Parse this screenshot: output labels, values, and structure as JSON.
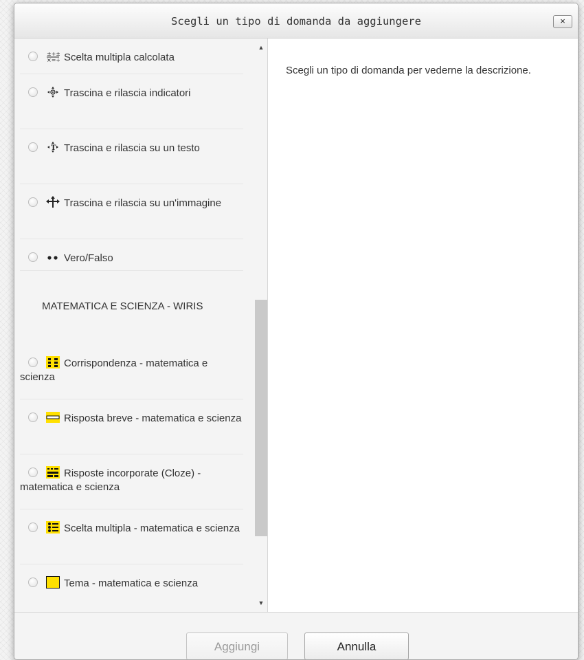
{
  "dialog": {
    "title": "Scegli un tipo di domanda da aggiungere",
    "close_glyph": "×"
  },
  "question_types": [
    {
      "label": "Scelta multipla calcolata",
      "icon": "calculated-multichoice-icon"
    },
    {
      "label": "Trascina e rilascia indicatori",
      "icon": "drag-drop-markers-icon"
    },
    {
      "label": "Trascina e rilascia su un testo",
      "icon": "drag-drop-text-icon"
    },
    {
      "label": "Trascina e rilascia su un'immagine",
      "icon": "drag-drop-image-icon"
    },
    {
      "label": "Vero/Falso",
      "icon": "true-false-icon"
    }
  ],
  "category": {
    "label": "MATEMATICA E SCIENZA - WIRIS"
  },
  "wiris_types": [
    {
      "label": "Corrispondenza - matematica e scienza",
      "icon": "wiris-match-icon"
    },
    {
      "label": "Risposta breve - matematica e scienza",
      "icon": "wiris-shortanswer-icon"
    },
    {
      "label": "Risposte incorporate (Cloze) - matematica e scienza",
      "icon": "wiris-cloze-icon"
    },
    {
      "label": "Scelta multipla - matematica e scienza",
      "icon": "wiris-multichoice-icon"
    },
    {
      "label": "Tema - matematica e scienza",
      "icon": "wiris-essay-icon"
    }
  ],
  "description": {
    "text": "Scegli un tipo di domanda per vederne la descrizione."
  },
  "buttons": {
    "add_label": "Aggiungi",
    "cancel_label": "Annulla"
  },
  "colors": {
    "wiris_icon": "#ffe000",
    "scroll_thumb": "#c9c9c9"
  }
}
